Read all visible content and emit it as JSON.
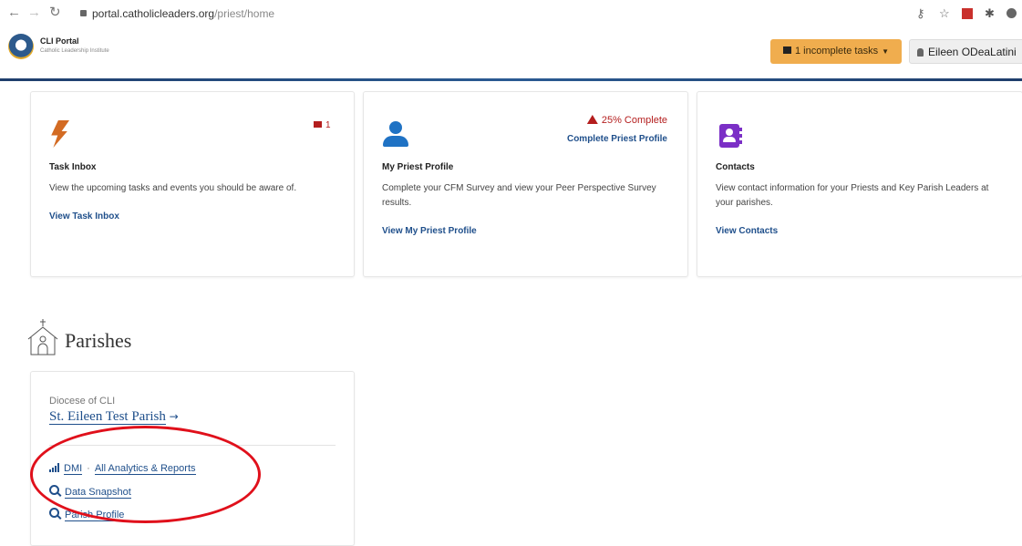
{
  "browser": {
    "url_host": "portal.catholicleaders.org",
    "url_path": "/priest/home"
  },
  "header": {
    "brand_title": "CLI Portal",
    "brand_subtitle": "Catholic Leadership Institute",
    "tasks_button": "1 incomplete tasks",
    "user_name": "Eileen ODeaLatini"
  },
  "cards": {
    "task_inbox": {
      "badge_count": "1",
      "title": "Task Inbox",
      "description": "View the upcoming tasks and events you should be aware of.",
      "link": "View Task Inbox"
    },
    "priest_profile": {
      "progress_text": "25% Complete",
      "complete_link": "Complete Priest Profile",
      "title": "My Priest Profile",
      "description": "Complete your CFM Survey and view your Peer Perspective Survey results.",
      "link": "View My Priest Profile"
    },
    "contacts": {
      "title": "Contacts",
      "description": "View contact information for your Priests and Key Parish Leaders at your parishes.",
      "link": "View Contacts"
    }
  },
  "parishes": {
    "section_title": "Parishes",
    "diocese": "Diocese of CLI",
    "parish_name": "St. Eileen Test Parish",
    "dmi_link": "DMI",
    "separator": "·",
    "analytics_link": "All Analytics & Reports",
    "snapshot_link": "Data Snapshot",
    "profile_link": "Parish Profile"
  },
  "colors": {
    "accent_blue": "#1f4f8b",
    "warning_orange": "#f0ad4e",
    "alert_red": "#b41e1e",
    "annotation_red": "#e0101b"
  }
}
